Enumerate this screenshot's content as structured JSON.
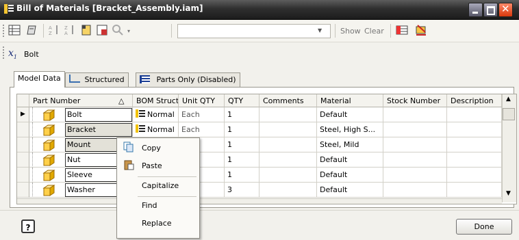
{
  "window": {
    "title": "Bill of Materials [Bracket_Assembly.iam]"
  },
  "toolbar": {
    "combo_value": "",
    "show_label": "Show",
    "clear_label": "Clear"
  },
  "current_part": "Bolt",
  "tabs": [
    {
      "label": "Model Data"
    },
    {
      "label": "Structured"
    },
    {
      "label": "Parts Only (Disabled)"
    }
  ],
  "grid": {
    "columns": [
      "Part Number",
      "BOM Struct...",
      "Unit QTY",
      "QTY",
      "Comments",
      "Material",
      "Stock Number",
      "Description"
    ],
    "sort_indicator": "△",
    "rows": [
      {
        "part": "Bolt",
        "bom": "Normal",
        "unit": "Each",
        "qty": "1",
        "material": "Default"
      },
      {
        "part": "Bracket",
        "bom": "Normal",
        "unit": "Each",
        "qty": "1",
        "material": "Steel, High S..."
      },
      {
        "part": "Mount",
        "bom": "",
        "unit": "",
        "qty": "1",
        "material": "Steel, Mild"
      },
      {
        "part": "Nut",
        "bom": "",
        "unit": "",
        "qty": "1",
        "material": "Default"
      },
      {
        "part": "Sleeve",
        "bom": "",
        "unit": "",
        "qty": "1",
        "material": "Default"
      },
      {
        "part": "Washer",
        "bom": "",
        "unit": "",
        "qty": "3",
        "material": "Default"
      }
    ]
  },
  "context_menu": {
    "copy": "Copy",
    "paste": "Paste",
    "capitalize": "Capitalize",
    "find": "Find",
    "replace": "Replace"
  },
  "footer": {
    "help_label": "?",
    "done_label": "Done"
  },
  "colors": {
    "titlebar": "#2f2f2f",
    "close_button": "#d8380c",
    "part_icon_fill": "#ffd86a"
  }
}
